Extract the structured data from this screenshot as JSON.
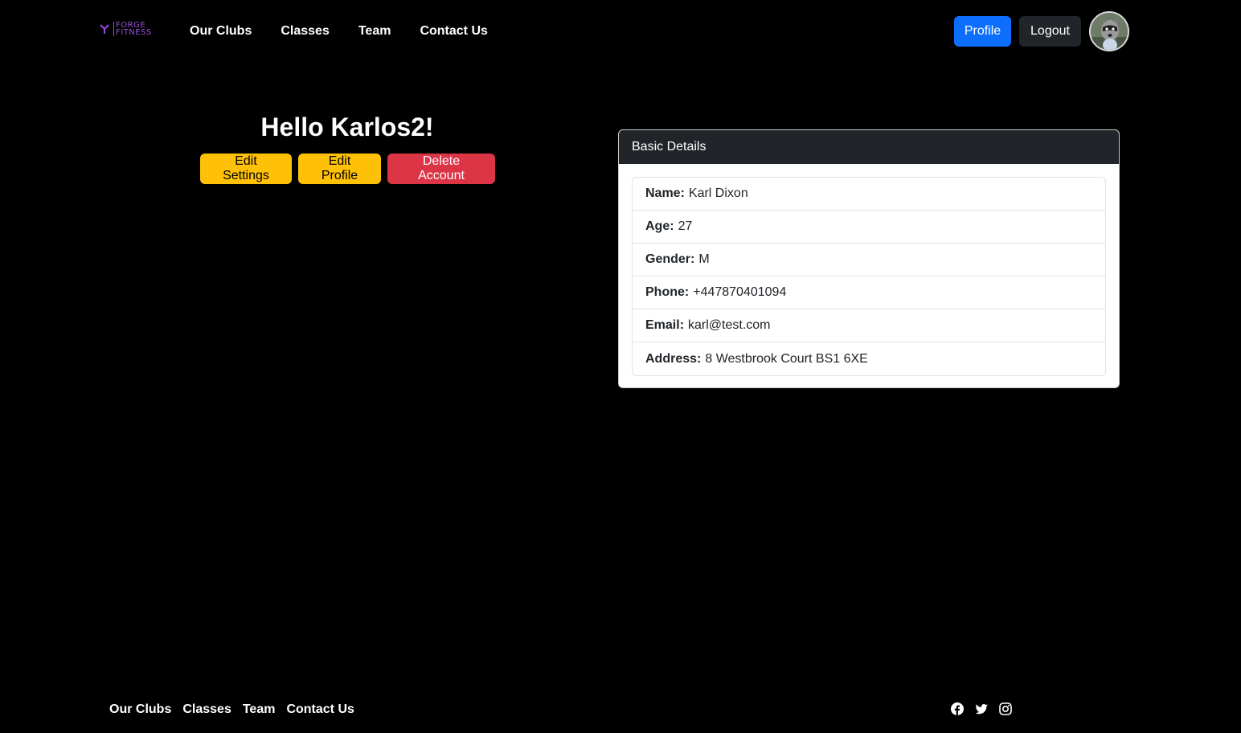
{
  "brand": {
    "line1": "FORGE",
    "line2": "FITNESS",
    "accent": "#9b4dde"
  },
  "nav": {
    "links": [
      "Our Clubs",
      "Classes",
      "Team",
      "Contact Us"
    ],
    "profile_label": "Profile",
    "logout_label": "Logout"
  },
  "greeting": "Hello Karlos2!",
  "actions": {
    "edit_settings": "Edit Settings",
    "edit_profile": "Edit Profile",
    "delete_account": "Delete Account"
  },
  "details": {
    "header": "Basic Details",
    "items": [
      {
        "label": "Name:",
        "value": "Karl Dixon"
      },
      {
        "label": "Age:",
        "value": "27"
      },
      {
        "label": "Gender:",
        "value": "M"
      },
      {
        "label": "Phone:",
        "value": "+447870401094"
      },
      {
        "label": "Email:",
        "value": "karl@test.com"
      },
      {
        "label": "Address:",
        "value": "8 Westbrook Court BS1 6XE"
      }
    ]
  },
  "footer": {
    "links": [
      "Our Clubs",
      "Classes",
      "Team",
      "Contact Us"
    ],
    "social_icons": [
      "facebook-icon",
      "twitter-icon",
      "instagram-icon"
    ]
  },
  "colors": {
    "primary": "#0d6efd",
    "warning": "#ffc107",
    "danger": "#dc3545",
    "dark": "#212529"
  }
}
